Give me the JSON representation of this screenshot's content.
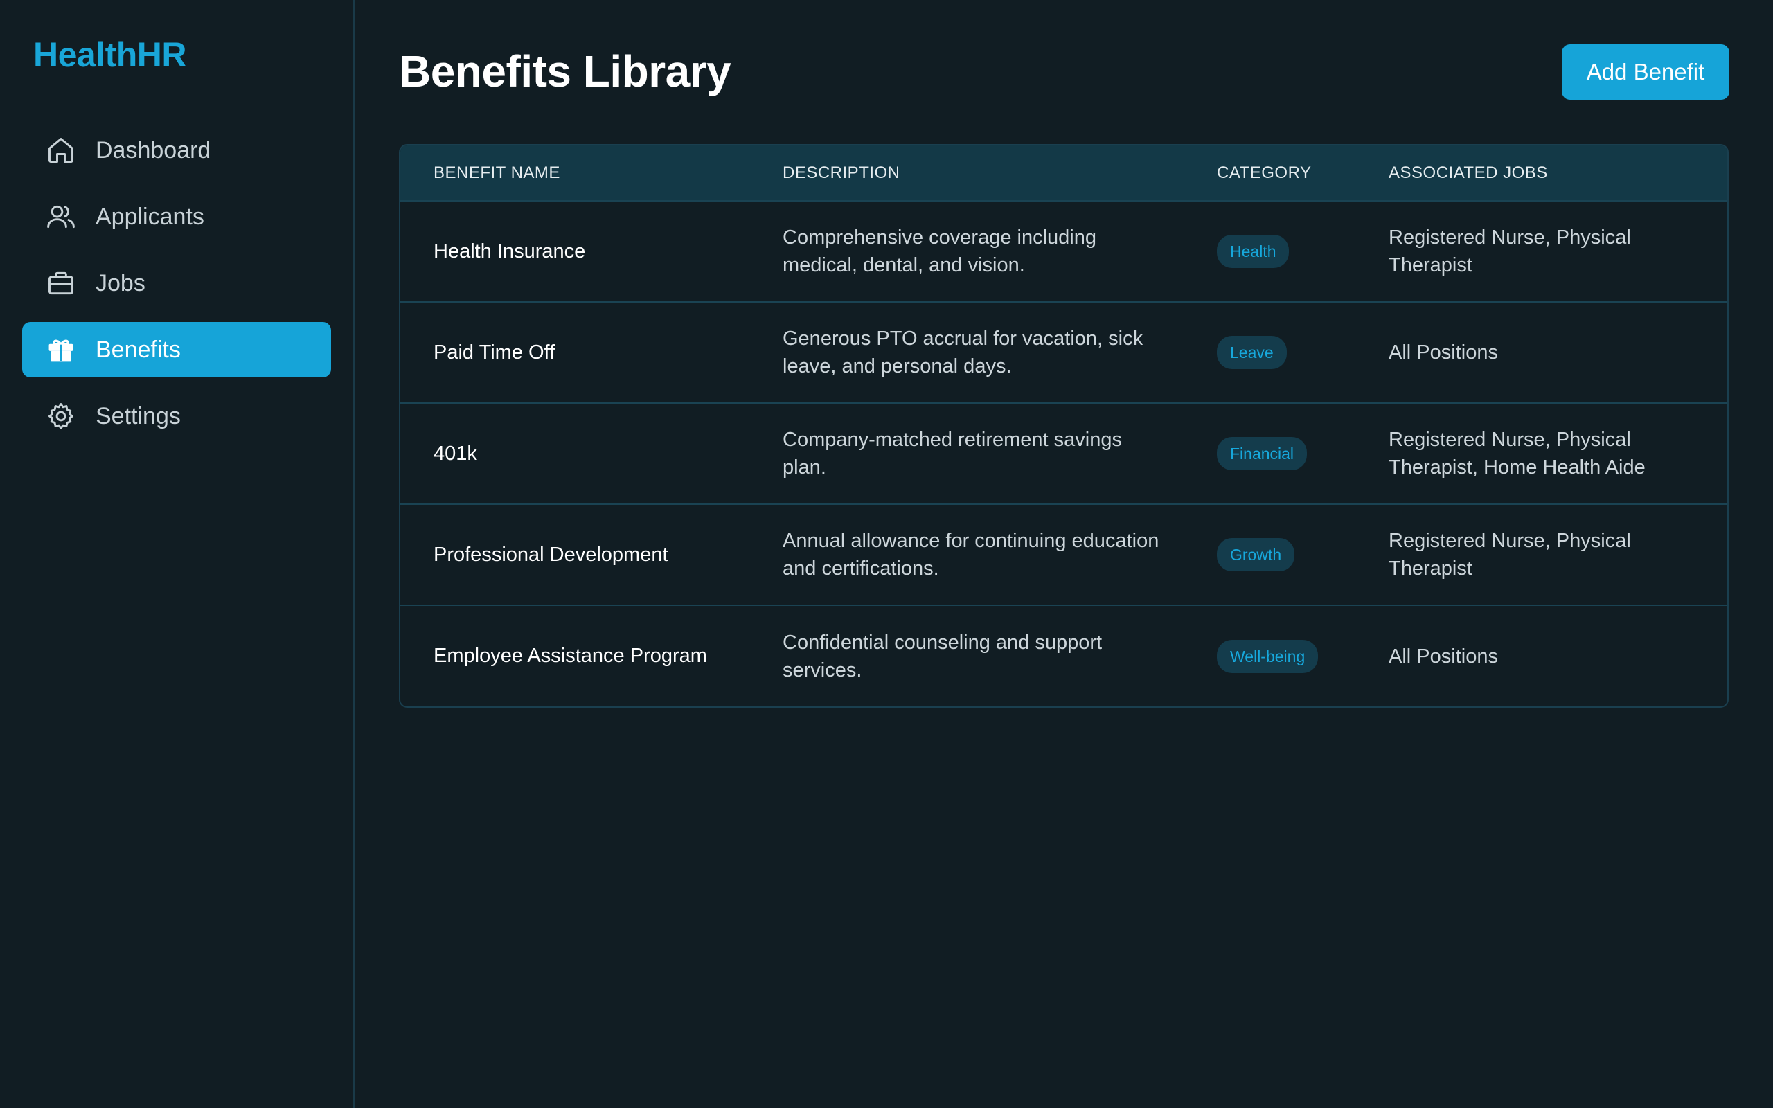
{
  "app": {
    "logo": "HealthHR"
  },
  "sidebar": {
    "items": [
      {
        "label": "Dashboard",
        "icon": "home-icon",
        "active": false
      },
      {
        "label": "Applicants",
        "icon": "users-icon",
        "active": false
      },
      {
        "label": "Jobs",
        "icon": "briefcase-icon",
        "active": false
      },
      {
        "label": "Benefits",
        "icon": "gift-icon",
        "active": true
      },
      {
        "label": "Settings",
        "icon": "gear-icon",
        "active": false
      }
    ]
  },
  "header": {
    "title": "Benefits Library",
    "add_button": "Add Benefit"
  },
  "table": {
    "columns": [
      "BENEFIT NAME",
      "DESCRIPTION",
      "CATEGORY",
      "ASSOCIATED JOBS"
    ],
    "rows": [
      {
        "name": "Health Insurance",
        "description": "Comprehensive coverage including medical, dental, and vision.",
        "category": "Health",
        "jobs": "Registered Nurse, Physical Therapist"
      },
      {
        "name": "Paid Time Off",
        "description": "Generous PTO accrual for vacation, sick leave, and personal days.",
        "category": "Leave",
        "jobs": "All Positions"
      },
      {
        "name": "401k",
        "description": "Company-matched retirement savings plan.",
        "category": "Financial",
        "jobs": "Registered Nurse, Physical Therapist, Home Health Aide"
      },
      {
        "name": "Professional Development",
        "description": "Annual allowance for continuing education and certifications.",
        "category": "Growth",
        "jobs": "Registered Nurse, Physical Therapist"
      },
      {
        "name": "Employee Assistance Program",
        "description": "Confidential counseling and support services.",
        "category": "Well-being",
        "jobs": "All Positions"
      }
    ]
  },
  "colors": {
    "background": "#111d23",
    "accent": "#16a4d8",
    "table_header": "#133947",
    "badge_bg": "#143c4c"
  }
}
